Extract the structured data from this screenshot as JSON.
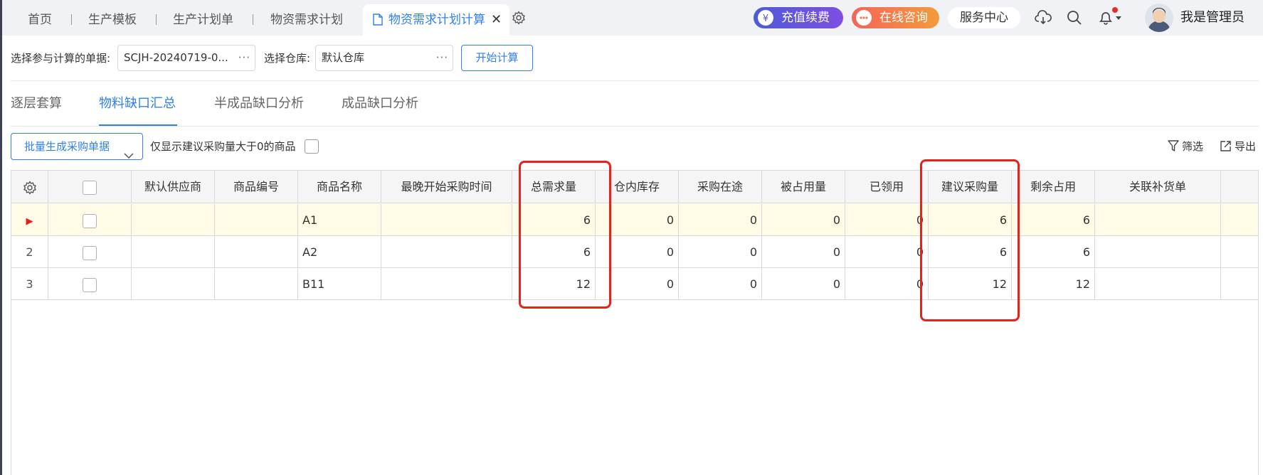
{
  "topbar": {
    "tabs": [
      "首页",
      "生产模板",
      "生产计划单",
      "物资需求计划"
    ],
    "active_tab": "物资需求计划计算",
    "close_glyph": "✕",
    "recharge": "充值续费",
    "consult": "在线咨询",
    "service": "服务中心",
    "username": "我是管理员",
    "icons": [
      "settings-icon",
      "cloud-download-icon",
      "search-icon",
      "bell-icon",
      "avatar"
    ]
  },
  "toolbar": {
    "doc_label": "选择参与计算的单据:",
    "doc_value": "SCJH-20240719-0...",
    "warehouse_label": "选择仓库:",
    "warehouse_value": "默认仓库",
    "dots": "···",
    "start_button": "开始计算"
  },
  "subtabs": [
    "逐层套算",
    "物料缺口汇总",
    "半成品缺口分析",
    "成品缺口分析"
  ],
  "actions": {
    "batch_button": "批量生成采购单据",
    "only_positive_label": "仅显示建议采购量大于0的商品",
    "filter": "筛选",
    "export": "导出"
  },
  "table": {
    "columns": [
      "默认供应商",
      "商品编号",
      "商品名称",
      "最晚开始采购时间",
      "总需求量",
      "仓内库存",
      "采购在途",
      "被占用量",
      "已领用",
      "建议采购量",
      "剩余占用",
      "关联补货单"
    ],
    "rows": [
      {
        "idx": "▶",
        "supplier": "",
        "code": "",
        "name": "A1",
        "latest_time": "",
        "total_demand": "6",
        "stock": "0",
        "in_transit": "0",
        "occupied": "0",
        "received": "0",
        "suggested": "6",
        "remaining": "6",
        "linked": ""
      },
      {
        "idx": "2",
        "supplier": "",
        "code": "",
        "name": "A2",
        "latest_time": "",
        "total_demand": "6",
        "stock": "0",
        "in_transit": "0",
        "occupied": "0",
        "received": "0",
        "suggested": "6",
        "remaining": "6",
        "linked": ""
      },
      {
        "idx": "3",
        "supplier": "",
        "code": "",
        "name": "B11",
        "latest_time": "",
        "total_demand": "12",
        "stock": "0",
        "in_transit": "0",
        "occupied": "0",
        "received": "0",
        "suggested": "12",
        "remaining": "12",
        "linked": ""
      }
    ]
  },
  "colors": {
    "accent": "#2f7ff0",
    "highlight": "#e8221b",
    "selected_row": "#fffbe6"
  }
}
